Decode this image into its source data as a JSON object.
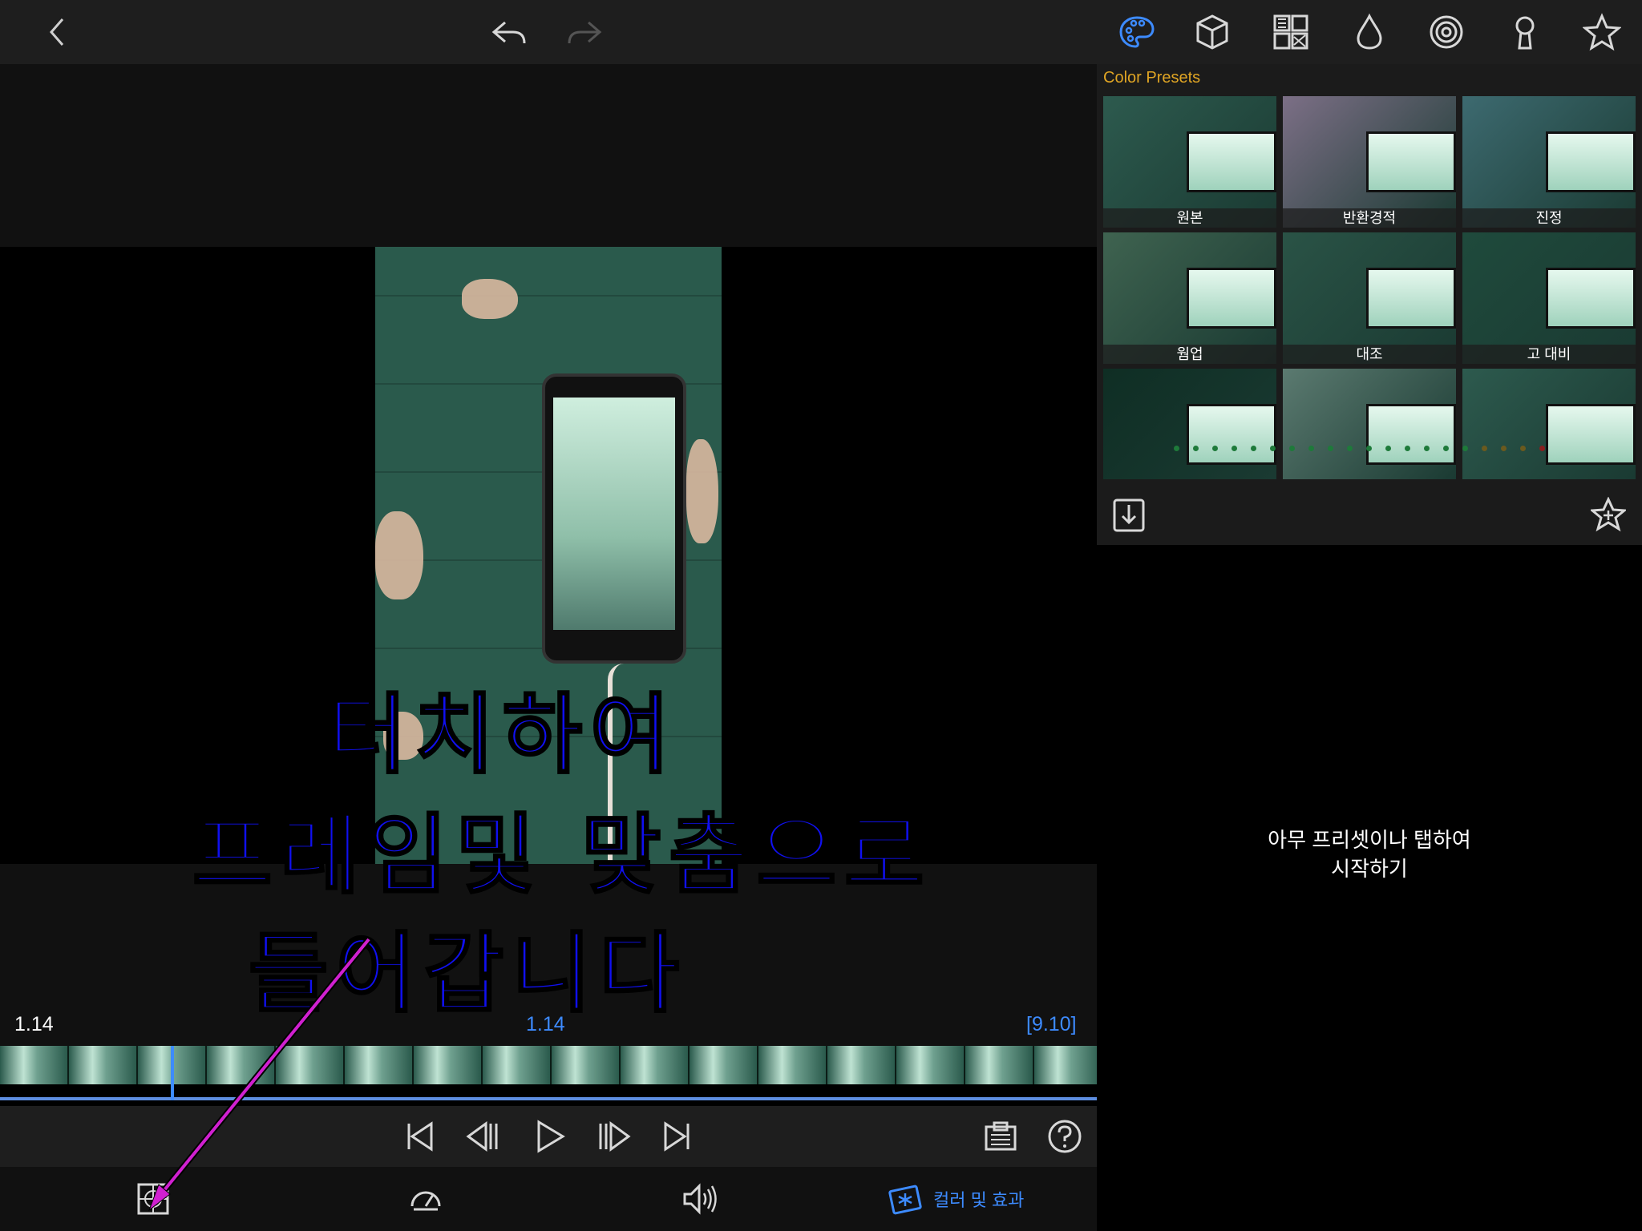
{
  "toolbar": {
    "icons": [
      "back-icon",
      "undo-icon",
      "redo-icon",
      "palette-icon",
      "cube-icon",
      "grid-icon",
      "drop-icon",
      "spiral-icon",
      "keyhole-icon",
      "star-icon"
    ]
  },
  "overlay": {
    "line1": "터치하여",
    "line2": "프레임및 맞춤으로",
    "line3": "들어갑니다"
  },
  "timeline": {
    "current_time_left": "1.14",
    "current_time_center": "1.14",
    "duration": "[9.10]"
  },
  "bottom_tabs": {
    "color_effects_label": "컬러 및 효과"
  },
  "presets": {
    "title": "Color Presets",
    "items": [
      {
        "label": "원본",
        "tint": "#2d5a4e"
      },
      {
        "label": "반환경적",
        "tint": "#7c6f86"
      },
      {
        "label": "진정",
        "tint": "#3d6a70"
      },
      {
        "label": "웜업",
        "tint": "#3f6350"
      },
      {
        "label": "대조",
        "tint": "#2a5346"
      },
      {
        "label": "고 대비",
        "tint": "#1f4a3c"
      },
      {
        "label": "",
        "tint": "#0f2e24"
      },
      {
        "label": "",
        "tint": "#5b7a70"
      },
      {
        "label": "",
        "tint": "#2d5a4e"
      }
    ],
    "hint_line1": "아무 프리셋이나 탭하여",
    "hint_line2": "시작하기"
  },
  "colors": {
    "accent": "#3d8bff",
    "preset_title": "#e0a524",
    "overlay_text": "#1010f0",
    "arrow": "#d020d0"
  }
}
